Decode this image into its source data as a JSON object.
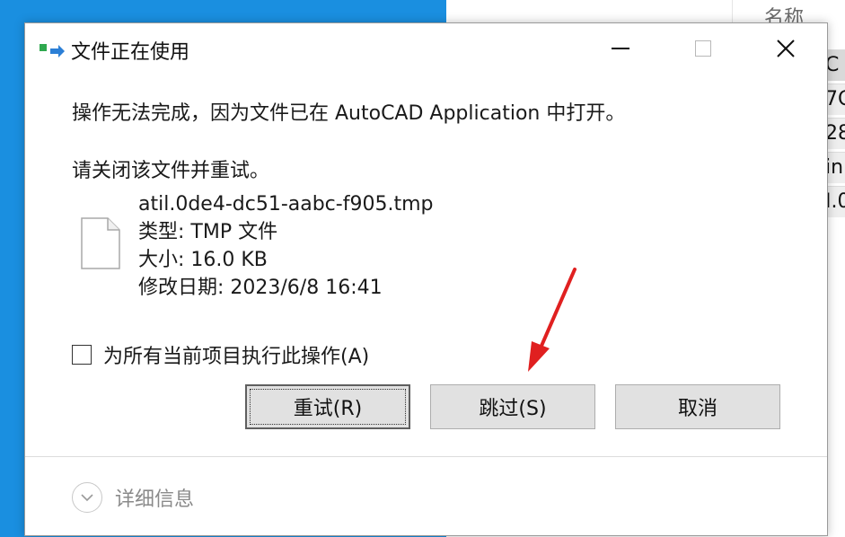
{
  "background_window": {
    "column_header": "名称",
    "cells": [
      "C",
      "7C",
      "28",
      "in",
      "I.0"
    ]
  },
  "dialog": {
    "title": "文件正在使用",
    "message": "操作无法完成，因为文件已在 AutoCAD Application 中打开。",
    "instruction": "请关闭该文件并重试。",
    "file": {
      "name": "atil.0de4-dc51-aabc-f905.tmp",
      "type": "类型: TMP 文件",
      "size": "大小: 16.0 KB",
      "modified": "修改日期: 2023/6/8 16:41"
    },
    "checkbox_label": "为所有当前项目执行此操作(A)",
    "checkbox_checked": false,
    "buttons": {
      "retry": "重试(R)",
      "skip": "跳过(S)",
      "cancel": "取消"
    },
    "details_label": "详细信息"
  },
  "colors": {
    "desktop": "#1a8fe0",
    "annotation_arrow": "#e02020",
    "icon_green": "#2fa84f",
    "icon_blue": "#2b7fd6"
  }
}
